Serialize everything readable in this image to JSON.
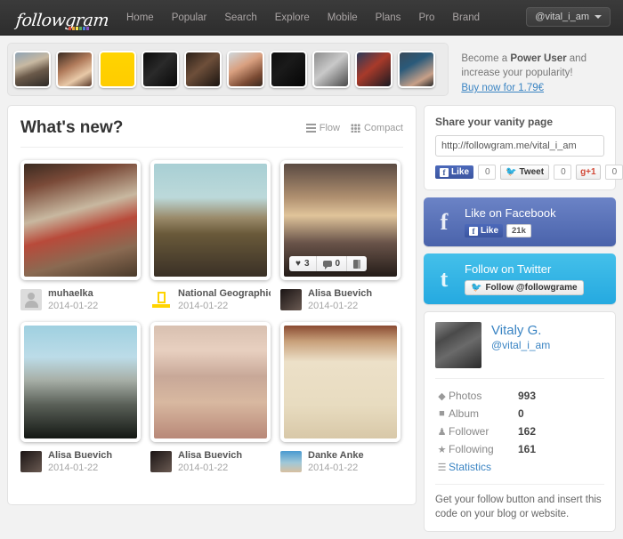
{
  "navbar": {
    "logo_text": "followgram",
    "logo_dot_colors": [
      "#d94a3d",
      "#e8a33d",
      "#f2e14c",
      "#5ba85b",
      "#4a7fd9",
      "#8a56c4"
    ],
    "links": [
      {
        "label": "Home"
      },
      {
        "label": "Popular"
      },
      {
        "label": "Search"
      },
      {
        "label": "Explore"
      },
      {
        "label": "Mobile"
      },
      {
        "label": "Plans"
      },
      {
        "label": "Pro"
      },
      {
        "label": "Brand"
      }
    ],
    "user_menu_label": "@vital_i_am",
    "caret_icon": "chevron-down-icon"
  },
  "strip": {
    "thumbs": [
      {
        "name": "thumb-1",
        "css": "linear-gradient(160deg,#8fa3b5 0%,#c8b9a2 35%,#6b5a4a 60%,#2e2a26 100%)"
      },
      {
        "name": "thumb-2",
        "css": "linear-gradient(150deg,#3a2b22 0%,#b07a5a 40%,#e8c9a8 70%,#5a3a2a 100%)"
      },
      {
        "name": "thumb-3",
        "css": "linear-gradient(#ffd400,#ffcc00)"
      },
      {
        "name": "thumb-4",
        "css": "linear-gradient(135deg,#0a0a0a 0%,#2a2a2a 45%,#080808 100%)"
      },
      {
        "name": "thumb-5",
        "css": "linear-gradient(140deg,#2b2018 0%,#6e4f3a 45%,#1a1410 100%)"
      },
      {
        "name": "thumb-6",
        "css": "linear-gradient(150deg,#cfd8dc 0%,#d9a080 40%,#7a4a33 75%,#3a2a20 100%)"
      },
      {
        "name": "thumb-7",
        "css": "linear-gradient(135deg,#0d0d0d 0%,#1a1a1a 40%,#050505 100%)"
      },
      {
        "name": "thumb-8",
        "css": "linear-gradient(140deg,#8d8d8d 0%,#c9c9c9 45%,#4a4a4a 100%)"
      },
      {
        "name": "thumb-9",
        "css": "linear-gradient(140deg,#2a3a5a 0%,#a83a2a 45%,#1a1a22 100%)"
      },
      {
        "name": "thumb-10",
        "css": "linear-gradient(150deg,#3a4a5a 0%,#2a5a7a 35%,#c8a088 75%,#2a2a2a 100%)"
      }
    ]
  },
  "promo": {
    "line1_pre": "Become a ",
    "line1_bold": "Power User",
    "line1_post": " and",
    "line2": "increase your popularity!",
    "link": "Buy now for 1.79€"
  },
  "main": {
    "title": "What's new?",
    "views": [
      {
        "label": "Flow",
        "icon": "list-lines-icon",
        "name": "view-flow"
      },
      {
        "label": "Compact",
        "icon": "grid-dots-icon",
        "name": "view-compact"
      }
    ],
    "posts": [
      {
        "user": "muhaelka",
        "date": "2014-01-22",
        "photo_css": "linear-gradient(165deg,#3a2a20 0%,#7a4a38 18%,#c8b8a0 42%,#b84a3a 58%,#8a6a52 78%,#4a3a2a 100%)",
        "avatar_css": "linear-gradient(#dcdcdc,#cfcfcf)",
        "avatar_kind": "placeholder",
        "badges": null
      },
      {
        "user": "National Geographic",
        "date": "2014-01-22",
        "photo_css": "linear-gradient(180deg,#a8cfd4 0%,#bcd9da 30%,#9a8a6a 48%,#6a5a3a 62%,#3a3026 100%)",
        "avatar_css": "linear-gradient(#fff,#f4f4f4)",
        "avatar_kind": "natgeo",
        "badges": null
      },
      {
        "user": "Alisa Buevich",
        "date": "2014-01-22",
        "photo_css": "linear-gradient(180deg,#5a4a42 0%,#b09070 30%,#e0c49a 46%,#6a544a 70%,#241c18 100%)",
        "avatar_css": "linear-gradient(140deg,#1a1414,#6a5a52)",
        "avatar_kind": "photo",
        "badges": {
          "likes": "3",
          "comments": "0",
          "album_icon": "album-icon"
        }
      },
      {
        "user": "Alisa Buevich",
        "date": "2014-01-22",
        "photo_css": "linear-gradient(180deg,#9fd0e0 0%,#bcdce8 28%,#a8b0a8 48%,#5a6058 70%,#141814 100%)",
        "avatar_css": "linear-gradient(140deg,#1a1414,#6a5a52)",
        "avatar_kind": "photo",
        "badges": null
      },
      {
        "user": "Alisa Buevich",
        "date": "2014-01-22",
        "photo_css": "linear-gradient(180deg,#d8c0b0 0%,#e8d0c0 22%,#c8a898 45%,#d8b8a0 68%,#b88878 100%)",
        "avatar_css": "linear-gradient(140deg,#1a1414,#6a5a52)",
        "avatar_kind": "photo",
        "badges": null
      },
      {
        "user": "Danke Anke",
        "date": "2014-01-22",
        "photo_css": "linear-gradient(180deg,#8a4a32 0%,#c8a07a 14%,#ece0c8 32%,#e8dcc0 70%,#d8c8a8 100%)",
        "avatar_css": "linear-gradient(180deg,#4a9ad0,#a0c8d8 55%,#d8c0a0)",
        "avatar_kind": "photo",
        "badges": null
      }
    ]
  },
  "sidebar": {
    "vanity": {
      "title": "Share your vanity page",
      "url": "http://followgram.me/vital_i_am",
      "facebook_label": "Like",
      "facebook_count": "0",
      "twitter_label": "Tweet",
      "twitter_count": "0",
      "gplus_label": "g+1",
      "gplus_count": "0"
    },
    "facebook_box": {
      "title": "Like on Facebook",
      "button_label": "Like",
      "count": "21k",
      "icon": "facebook-icon",
      "color": "#4a63ab"
    },
    "twitter_box": {
      "title": "Follow on Twitter",
      "button_label": "Follow @followgrame",
      "icon": "twitter-icon",
      "color": "#25a9e0"
    },
    "profile": {
      "name": "Vitaly G.",
      "handle": "@vital_i_am",
      "avatar_css": "linear-gradient(150deg,#8a8a8a 0%,#4a4a4a 30%,#6a6a6a 55%,#2a2a2a 100%)",
      "stats": [
        {
          "icon": "drop-icon",
          "glyph": "◆",
          "label": "Photos",
          "value": "993"
        },
        {
          "icon": "album-icon",
          "glyph": "■",
          "label": "Album",
          "value": "0"
        },
        {
          "icon": "user-icon",
          "glyph": "♟",
          "label": "Follower",
          "value": "162"
        },
        {
          "icon": "star-icon",
          "glyph": "★",
          "label": "Following",
          "value": "161"
        }
      ],
      "statistics_label": "Statistics",
      "statistics_icon": "bar-chart-icon"
    },
    "code_note": "Get your follow button and insert this code on your blog or website."
  }
}
